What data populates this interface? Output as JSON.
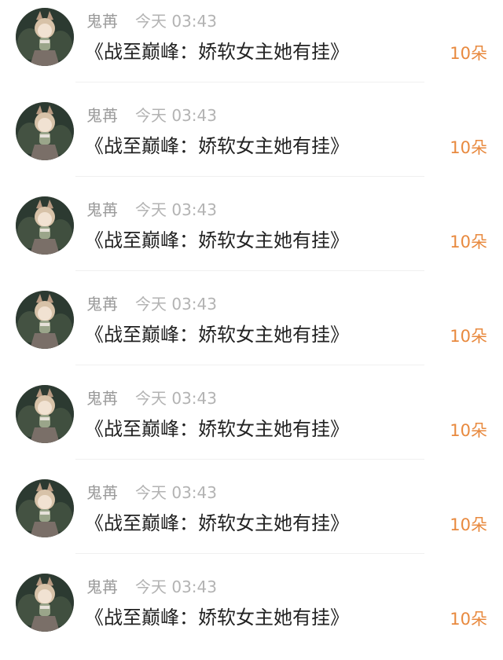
{
  "colors": {
    "name": "#9a9a9a",
    "time": "#b3b3b3",
    "message": "#222222",
    "gift": "#e8893e",
    "divider": "#f0f0f0"
  },
  "rows": [
    {
      "avatar_icon": "anime-girl-avatar-icon",
      "name": "鬼苒",
      "time": "今天 03:43",
      "message": "《战至巅峰：娇软女主她有挂》",
      "gift": "10朵"
    },
    {
      "avatar_icon": "anime-girl-avatar-icon",
      "name": "鬼苒",
      "time": "今天 03:43",
      "message": "《战至巅峰：娇软女主她有挂》",
      "gift": "10朵"
    },
    {
      "avatar_icon": "anime-girl-avatar-icon",
      "name": "鬼苒",
      "time": "今天 03:43",
      "message": "《战至巅峰：娇软女主她有挂》",
      "gift": "10朵"
    },
    {
      "avatar_icon": "anime-girl-avatar-icon",
      "name": "鬼苒",
      "time": "今天 03:43",
      "message": "《战至巅峰：娇软女主她有挂》",
      "gift": "10朵"
    },
    {
      "avatar_icon": "anime-girl-avatar-icon",
      "name": "鬼苒",
      "time": "今天 03:43",
      "message": "《战至巅峰：娇软女主她有挂》",
      "gift": "10朵"
    },
    {
      "avatar_icon": "anime-girl-avatar-icon",
      "name": "鬼苒",
      "time": "今天 03:43",
      "message": "《战至巅峰：娇软女主她有挂》",
      "gift": "10朵"
    },
    {
      "avatar_icon": "anime-girl-avatar-icon",
      "name": "鬼苒",
      "time": "今天 03:43",
      "message": "《战至巅峰：娇软女主她有挂》",
      "gift": "10朵"
    }
  ]
}
